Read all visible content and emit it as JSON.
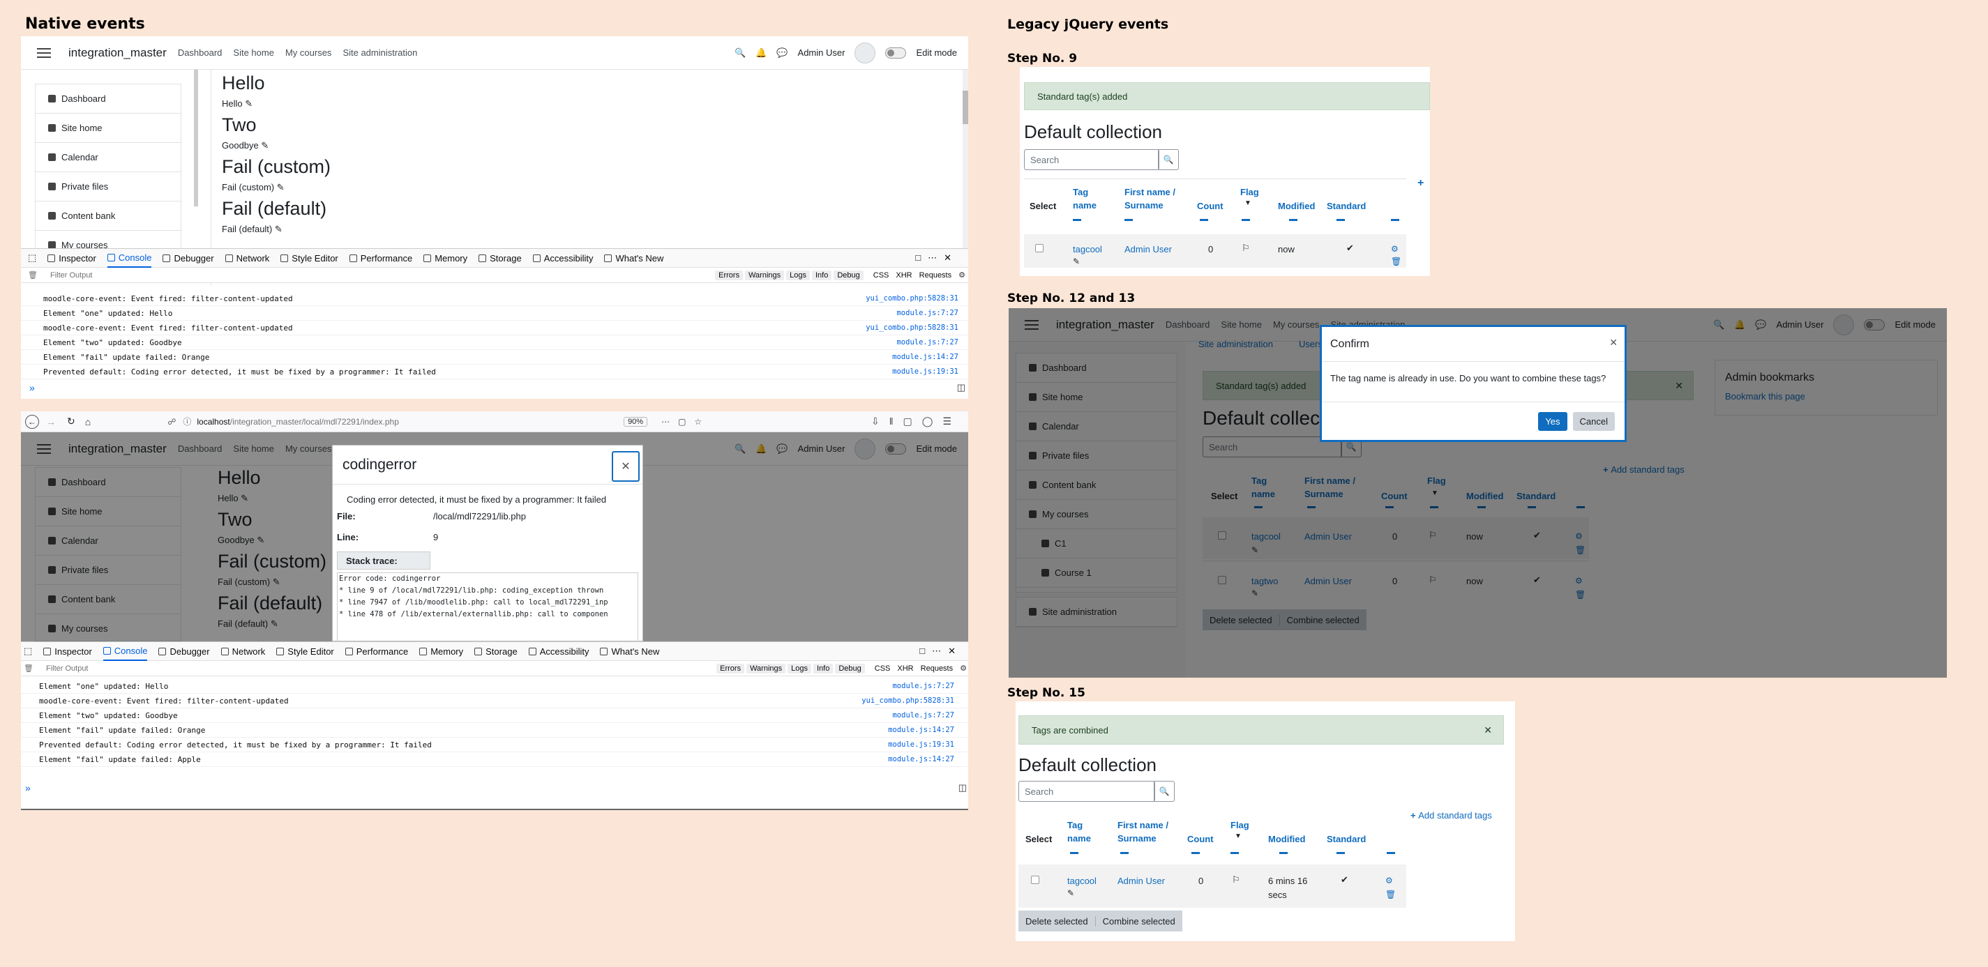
{
  "headings": {
    "native": "Native events",
    "legacy": "Legacy jQuery events",
    "step9": "Step  No. 9",
    "step12": "Step  No. 12 and 13",
    "step15": "Step  No. 15"
  },
  "moodle": {
    "brand": "integration_master",
    "nav": [
      "Dashboard",
      "Site home",
      "My courses",
      "Site administration"
    ],
    "user": "Admin User",
    "edit_mode": "Edit mode",
    "sidebar": [
      "Dashboard",
      "Site home",
      "Calendar",
      "Private files",
      "Content bank",
      "My courses"
    ],
    "content": [
      {
        "big": "Hello",
        "small": "Hello"
      },
      {
        "big": "Two",
        "small": "Goodbye"
      },
      {
        "big": "Fail (custom)",
        "small": "Fail (custom)"
      },
      {
        "big": "Fail (default)",
        "small": "Fail (default)"
      }
    ]
  },
  "devtools": {
    "tabs": [
      "Inspector",
      "Console",
      "Debugger",
      "Network",
      "Style Editor",
      "Performance",
      "Memory",
      "Storage",
      "Accessibility",
      "What's New"
    ],
    "filter_placeholder": "Filter Output",
    "filters": [
      "Errors",
      "Warnings",
      "Logs",
      "Info",
      "Debug"
    ],
    "filters_right": [
      "CSS",
      "XHR",
      "Requests"
    ],
    "log1": [
      {
        "msg": "moodle-core-event: Event fired: filter-content-updated",
        "src": "yui_combo.php:5828:31"
      },
      {
        "msg": "Element \"one\" updated: Hello",
        "src": "module.js:7:27"
      },
      {
        "msg": "moodle-core-event: Event fired: filter-content-updated",
        "src": "yui_combo.php:5828:31"
      },
      {
        "msg": "Element \"two\" updated: Goodbye",
        "src": "module.js:7:27"
      },
      {
        "msg": "Element \"fail\" update failed: Orange",
        "src": "module.js:14:27"
      },
      {
        "msg": "Prevented default: Coding error detected, it must be fixed by a programmer: It failed",
        "src": "module.js:19:31"
      }
    ],
    "log2": [
      {
        "msg": "Element \"one\" updated: Hello",
        "src": "module.js:7:27"
      },
      {
        "msg": "moodle-core-event: Event fired: filter-content-updated",
        "src": "yui_combo.php:5828:31"
      },
      {
        "msg": "Element \"two\" updated: Goodbye",
        "src": "module.js:7:27"
      },
      {
        "msg": "Element \"fail\" update failed: Orange",
        "src": "module.js:14:27"
      },
      {
        "msg": "Prevented default: Coding error detected, it must be fixed by a programmer: It failed",
        "src": "module.js:19:31"
      },
      {
        "msg": "Element \"fail\" update failed: Apple",
        "src": "module.js:14:27"
      }
    ]
  },
  "browser": {
    "url_host": "localhost",
    "url_path": "/integration_master/local/mdl72291/index.php",
    "zoom": "90%"
  },
  "error_modal": {
    "title": "codingerror",
    "message": "Coding error detected, it must be fixed by a programmer: It failed",
    "file_label": "File:",
    "file_value": "/local/mdl72291/lib.php",
    "line_label": "Line:",
    "line_value": "9",
    "stack_button": "Stack trace:",
    "stack": [
      "Error code: codingerror",
      "* line 9 of /local/mdl72291/lib.php: coding_exception thrown",
      "* line 7947 of /lib/moodlelib.php: call to local_mdl72291_inp",
      "* line 478 of /lib/external/externallib.php: call to componen"
    ]
  },
  "tags": {
    "alert_added": "Standard tag(s) added",
    "alert_combined": "Tags are combined",
    "page_title": "Default collection",
    "search_placeholder": "Search",
    "add_link": "Add standard tags",
    "headers": [
      "Select",
      "Tag name",
      "First name / Surname",
      "Count",
      "Flag",
      "Modified",
      "Standard"
    ],
    "rows_step9": [
      {
        "tag": "tagcool",
        "user": "Admin User",
        "count": "0",
        "modified": "now"
      }
    ],
    "rows_step12": [
      {
        "tag": "tagcool",
        "user": "Admin User",
        "count": "0",
        "modified": "now"
      },
      {
        "tag": "tagtwo",
        "user": "Admin User",
        "count": "0",
        "modified": "now"
      }
    ],
    "rows_step15": [
      {
        "tag": "tagcool",
        "user": "Admin User",
        "count": "0",
        "modified": "6 mins 16 secs"
      }
    ],
    "delete_selected": "Delete selected",
    "combine_selected": "Combine selected",
    "admin_bookmarks": "Admin bookmarks",
    "bookmark_page": "Bookmark this page",
    "site_admin_crumb": "Site administration",
    "users_crumb": "Users",
    "courses": [
      "C1",
      "Course 1"
    ],
    "sidebar12": [
      "Dashboard",
      "Site home",
      "Calendar",
      "Private files",
      "Content bank",
      "My courses"
    ],
    "site_admin_side": "Site administration"
  },
  "confirm": {
    "title": "Confirm",
    "message": "The tag name is already in use. Do you want to combine these tags?",
    "yes": "Yes",
    "cancel": "Cancel"
  }
}
